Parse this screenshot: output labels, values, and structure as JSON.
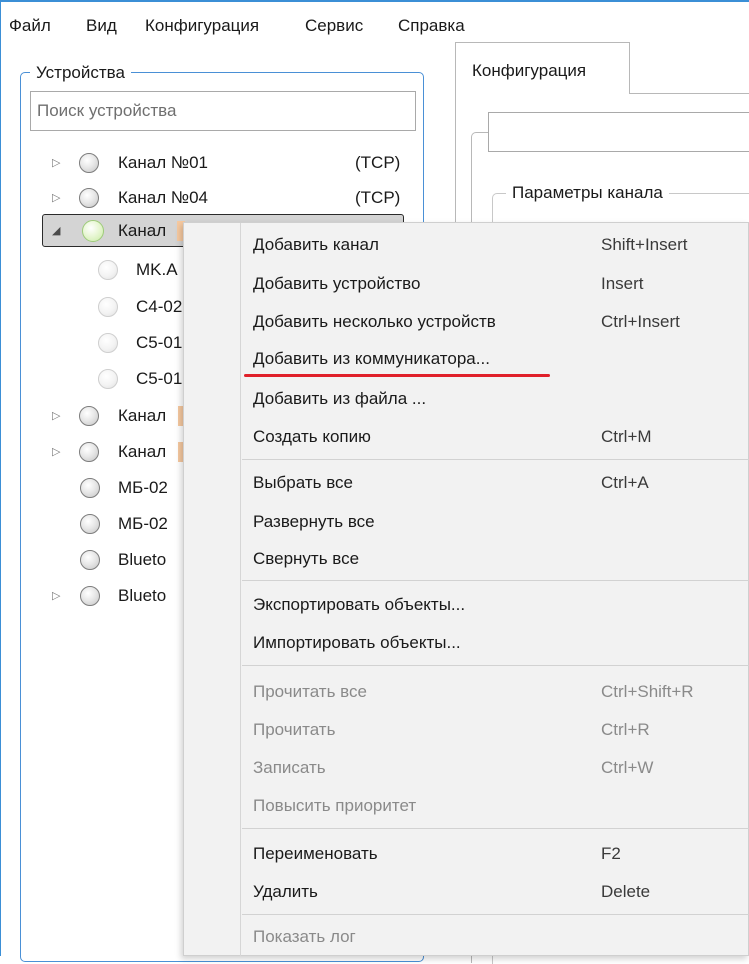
{
  "menubar": {
    "file": "Файл",
    "view": "Вид",
    "config": "Конфигурация",
    "service": "Сервис",
    "help": "Справка"
  },
  "devices": {
    "legend": "Устройства",
    "search_placeholder": "Поиск устройства",
    "rows": [
      {
        "label": "Канал №01",
        "proto": "(TCP)"
      },
      {
        "label": "Канал №04",
        "proto": "(TCP)"
      },
      {
        "label": "Канал"
      },
      {
        "label": "MK.A"
      },
      {
        "label": "C4-02"
      },
      {
        "label": "C5-01"
      },
      {
        "label": "C5-01"
      },
      {
        "label": "Канал"
      },
      {
        "label": "Канал"
      },
      {
        "label": "МБ-02"
      },
      {
        "label": "МБ-02"
      },
      {
        "label": "Blueto"
      },
      {
        "label": "Blueto"
      }
    ]
  },
  "right": {
    "tab_label": "Конфигурация",
    "params_legend": "Параметры канала"
  },
  "context_menu": {
    "items": [
      {
        "label": "Добавить канал",
        "shortcut": "Shift+Insert"
      },
      {
        "label": "Добавить устройство",
        "shortcut": "Insert"
      },
      {
        "label": "Добавить несколько устройств",
        "shortcut": "Ctrl+Insert"
      },
      {
        "label": "Добавить из коммуникатора...",
        "shortcut": ""
      },
      {
        "label": "Добавить из файла ...",
        "shortcut": ""
      },
      {
        "label": "Создать копию",
        "shortcut": "Ctrl+M"
      },
      {
        "label": "Выбрать все",
        "shortcut": "Ctrl+A"
      },
      {
        "label": "Развернуть все",
        "shortcut": ""
      },
      {
        "label": "Свернуть все",
        "shortcut": ""
      },
      {
        "label": "Экспортировать объекты...",
        "shortcut": ""
      },
      {
        "label": "Импортировать объекты...",
        "shortcut": ""
      },
      {
        "label": "Прочитать все",
        "shortcut": "Ctrl+Shift+R"
      },
      {
        "label": "Прочитать",
        "shortcut": "Ctrl+R"
      },
      {
        "label": "Записать",
        "shortcut": "Ctrl+W"
      },
      {
        "label": "Повысить приоритет",
        "shortcut": ""
      },
      {
        "label": "Переименовать",
        "shortcut": "F2"
      },
      {
        "label": "Удалить",
        "shortcut": "Delete"
      },
      {
        "label": "Показать лог",
        "shortcut": ""
      }
    ]
  },
  "colors": {
    "accent": "#3b8fd6",
    "highlight_underline": "#e0202a",
    "selected_row": "#d4d4d4",
    "menu_bg": "#f2f2f2"
  }
}
